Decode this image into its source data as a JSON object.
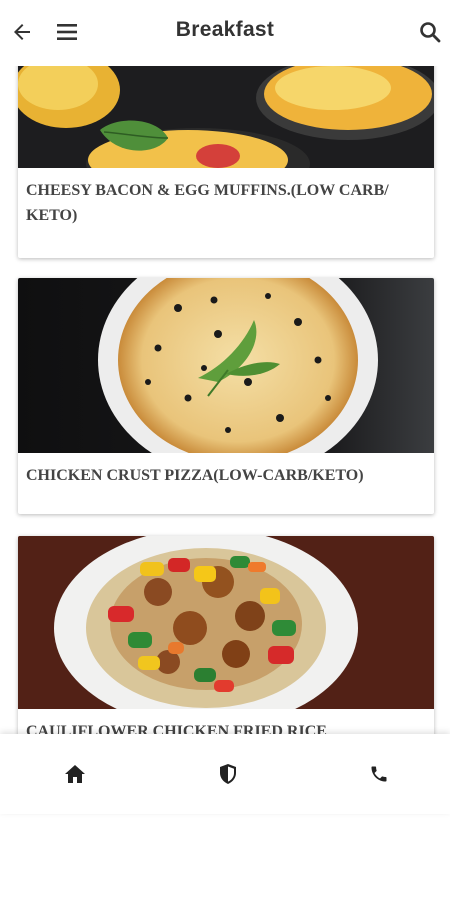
{
  "header": {
    "title": "Breakfast",
    "back_icon": "arrow-left-icon",
    "menu_icon": "hamburger-menu-icon",
    "search_icon": "search-icon"
  },
  "recipes": [
    {
      "title": "CHEESY BACON & EGG MUFFINS.(LOW CARB/ KETO)",
      "image": "egg-muffins-photo"
    },
    {
      "title": "CHICKEN CRUST PIZZA(LOW-CARB/KETO)",
      "image": "chicken-crust-pizza-photo"
    },
    {
      "title": "CAULIFLOWER CHICKEN FRIED RICE",
      "image": "cauliflower-fried-rice-photo"
    }
  ],
  "bottom_nav": {
    "home_icon": "home-icon",
    "shield_icon": "shield-icon",
    "phone_icon": "phone-icon"
  },
  "colors": {
    "title_text": "#333333",
    "card_title_text": "#444444",
    "icon": "#333333"
  }
}
